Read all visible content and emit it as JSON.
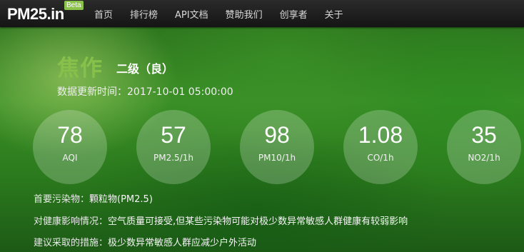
{
  "brand": {
    "name": "PM25.in",
    "badge": "Beta"
  },
  "nav": [
    "首页",
    "排行榜",
    "API文档",
    "赞助我们",
    "创享者",
    "关于"
  ],
  "city": "焦作",
  "level": "二级（良）",
  "update": "数据更新时间：2017-10-01 05:00:00",
  "metrics": [
    {
      "value": "78",
      "label": "AQI"
    },
    {
      "value": "57",
      "label": "PM2.5/1h"
    },
    {
      "value": "98",
      "label": "PM10/1h"
    },
    {
      "value": "1.08",
      "label": "CO/1h"
    },
    {
      "value": "35",
      "label": "NO2/1h"
    }
  ],
  "info": [
    {
      "key": "首要污染物：",
      "value": "颗粒物(PM2.5)"
    },
    {
      "key": "对健康影响情况：",
      "value": "空气质量可接受,但某些污染物可能对极少数异常敏感人群健康有较弱影响"
    },
    {
      "key": "建议采取的措施：",
      "value": "极少数异常敏感人群应减少户外活动"
    }
  ]
}
